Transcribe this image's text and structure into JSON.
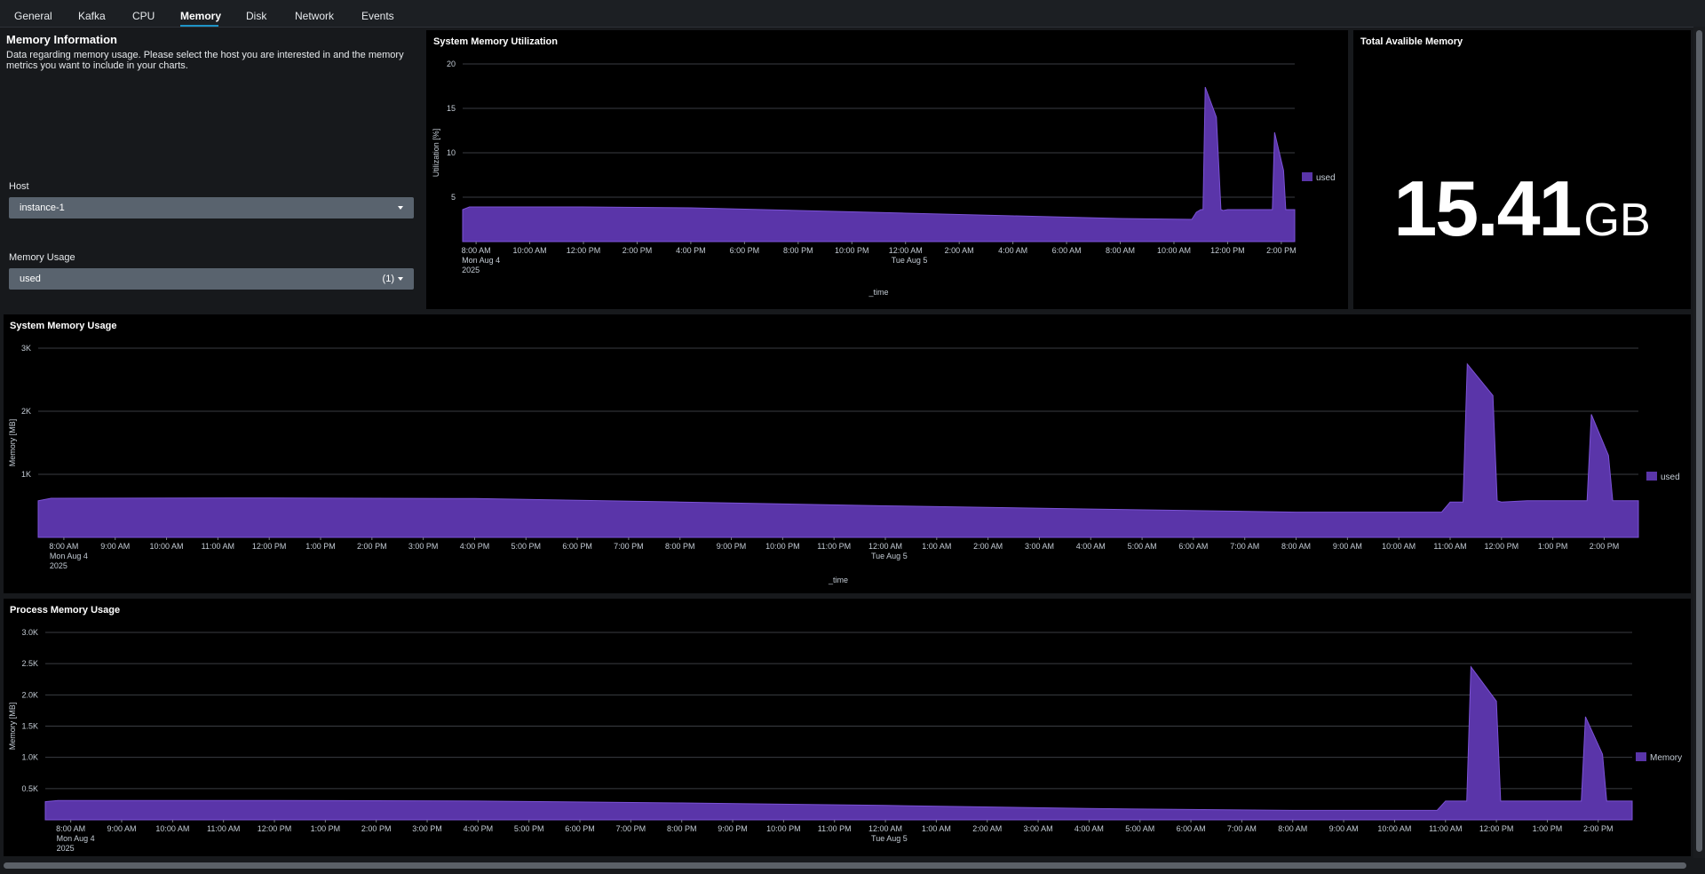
{
  "tabs": [
    {
      "label": "General"
    },
    {
      "label": "Kafka"
    },
    {
      "label": "CPU"
    },
    {
      "label": "Memory",
      "active": true
    },
    {
      "label": "Disk"
    },
    {
      "label": "Network"
    },
    {
      "label": "Events"
    }
  ],
  "info": {
    "title": "Memory Information",
    "description": "Data regarding memory usage. Please select the host you are interested in and the memory metrics you want to include in your charts."
  },
  "host_filter": {
    "label": "Host",
    "value": "instance-1"
  },
  "memory_filter": {
    "label": "Memory Usage",
    "value": "used",
    "count": "(1)"
  },
  "total_memory": {
    "title": "Total Avalible Memory",
    "value": "15.41",
    "unit": "GB"
  },
  "colors": {
    "series": "#5a35a9",
    "series_edge": "#7b52d6",
    "panel_bg": "#000000",
    "page_bg": "#17191c",
    "accent": "#1e93c6"
  },
  "icons": {
    "dropdown": "caret-down-icon"
  },
  "chart_data": [
    {
      "type": "area",
      "title": "System Memory Utilization",
      "xlabel": "_time",
      "ylabel": "Utilization [%]",
      "ylim": [
        0,
        20
      ],
      "yticks": [
        5,
        10,
        15,
        20
      ],
      "yticklabels": [
        "5",
        "10",
        "15",
        "20"
      ],
      "xlim": [
        "2025-08-04 07:30",
        "2025-08-05 14:30"
      ],
      "xticks": [
        "2025-08-04 08:00",
        "2025-08-04 10:00",
        "2025-08-04 12:00",
        "2025-08-04 14:00",
        "2025-08-04 16:00",
        "2025-08-04 18:00",
        "2025-08-04 20:00",
        "2025-08-04 22:00",
        "2025-08-05 00:00",
        "2025-08-05 02:00",
        "2025-08-05 04:00",
        "2025-08-05 06:00",
        "2025-08-05 08:00",
        "2025-08-05 10:00",
        "2025-08-05 12:00",
        "2025-08-05 14:00"
      ],
      "xticklabels": [
        "8:00 AM",
        "10:00 AM",
        "12:00 PM",
        "2:00 PM",
        "4:00 PM",
        "6:00 PM",
        "8:00 PM",
        "10:00 PM",
        "12:00 AM",
        "2:00 AM",
        "4:00 AM",
        "6:00 AM",
        "8:00 AM",
        "10:00 AM",
        "12:00 PM",
        "2:00 PM"
      ],
      "xsublabels": [
        [
          "Mon Aug 4",
          "2025"
        ],
        [],
        [],
        [],
        [],
        [],
        [],
        [],
        [
          "Tue Aug 5"
        ],
        [],
        [],
        [],
        [],
        [],
        [],
        []
      ],
      "legend": "right",
      "grid": true,
      "series": [
        {
          "name": "used",
          "x": [
            "2025-08-04 07:30",
            "2025-08-04 07:45",
            "2025-08-04 12:00",
            "2025-08-04 16:00",
            "2025-08-04 20:00",
            "2025-08-05 00:00",
            "2025-08-05 04:00",
            "2025-08-05 08:00",
            "2025-08-05 10:40",
            "2025-08-05 10:50",
            "2025-08-05 11:00",
            "2025-08-05 11:05",
            "2025-08-05 11:10",
            "2025-08-05 11:35",
            "2025-08-05 11:45",
            "2025-08-05 11:50",
            "2025-08-05 12:00",
            "2025-08-05 12:30",
            "2025-08-05 13:40",
            "2025-08-05 13:45",
            "2025-08-05 14:05",
            "2025-08-05 14:10",
            "2025-08-05 14:20",
            "2025-08-05 14:30"
          ],
          "values": [
            3.6,
            3.9,
            3.9,
            3.8,
            3.5,
            3.2,
            2.9,
            2.6,
            2.5,
            3.3,
            3.6,
            3.6,
            17.4,
            14.0,
            3.6,
            3.5,
            3.6,
            3.6,
            3.6,
            12.3,
            8.0,
            3.6,
            3.6,
            3.6
          ]
        }
      ]
    },
    {
      "type": "area",
      "title": "System Memory Usage",
      "xlabel": "_time",
      "ylabel": "Memory [MB]",
      "ylim": [
        0,
        3000
      ],
      "yticks": [
        1000,
        2000,
        3000
      ],
      "yticklabels": [
        "1K",
        "2K",
        "3K"
      ],
      "xlim": [
        "2025-08-04 07:30",
        "2025-08-05 14:40"
      ],
      "xticks": [
        "2025-08-04 08:00",
        "2025-08-04 09:00",
        "2025-08-04 10:00",
        "2025-08-04 11:00",
        "2025-08-04 12:00",
        "2025-08-04 13:00",
        "2025-08-04 14:00",
        "2025-08-04 15:00",
        "2025-08-04 16:00",
        "2025-08-04 17:00",
        "2025-08-04 18:00",
        "2025-08-04 19:00",
        "2025-08-04 20:00",
        "2025-08-04 21:00",
        "2025-08-04 22:00",
        "2025-08-04 23:00",
        "2025-08-05 00:00",
        "2025-08-05 01:00",
        "2025-08-05 02:00",
        "2025-08-05 03:00",
        "2025-08-05 04:00",
        "2025-08-05 05:00",
        "2025-08-05 06:00",
        "2025-08-05 07:00",
        "2025-08-05 08:00",
        "2025-08-05 09:00",
        "2025-08-05 10:00",
        "2025-08-05 11:00",
        "2025-08-05 12:00",
        "2025-08-05 13:00",
        "2025-08-05 14:00"
      ],
      "xticklabels": [
        "8:00 AM",
        "9:00 AM",
        "10:00 AM",
        "11:00 AM",
        "12:00 PM",
        "1:00 PM",
        "2:00 PM",
        "3:00 PM",
        "4:00 PM",
        "5:00 PM",
        "6:00 PM",
        "7:00 PM",
        "8:00 PM",
        "9:00 PM",
        "10:00 PM",
        "11:00 PM",
        "12:00 AM",
        "1:00 AM",
        "2:00 AM",
        "3:00 AM",
        "4:00 AM",
        "5:00 AM",
        "6:00 AM",
        "7:00 AM",
        "8:00 AM",
        "9:00 AM",
        "10:00 AM",
        "11:00 AM",
        "12:00 PM",
        "1:00 PM",
        "2:00 PM"
      ],
      "xsublabels": [
        [
          "Mon Aug 4",
          "2025"
        ],
        [],
        [],
        [],
        [],
        [],
        [],
        [],
        [],
        [],
        [],
        [],
        [],
        [],
        [],
        [],
        [
          "Tue Aug 5"
        ],
        [],
        [],
        [],
        [],
        [],
        [],
        [],
        [],
        [],
        [],
        [],
        [],
        [],
        []
      ],
      "legend": "right",
      "grid": true,
      "series": [
        {
          "name": "used",
          "x": [
            "2025-08-04 07:30",
            "2025-08-04 07:45",
            "2025-08-04 12:00",
            "2025-08-04 16:00",
            "2025-08-04 20:00",
            "2025-08-05 00:00",
            "2025-08-05 04:00",
            "2025-08-05 08:00",
            "2025-08-05 10:50",
            "2025-08-05 11:00",
            "2025-08-05 11:10",
            "2025-08-05 11:15",
            "2025-08-05 11:20",
            "2025-08-05 11:50",
            "2025-08-05 11:55",
            "2025-08-05 12:00",
            "2025-08-05 12:30",
            "2025-08-05 13:40",
            "2025-08-05 13:45",
            "2025-08-05 14:05",
            "2025-08-05 14:10",
            "2025-08-05 14:20",
            "2025-08-05 14:40"
          ],
          "values": [
            580,
            620,
            625,
            615,
            560,
            500,
            450,
            400,
            400,
            560,
            560,
            560,
            2750,
            2250,
            580,
            560,
            580,
            580,
            1950,
            1300,
            580,
            580,
            580
          ]
        }
      ]
    },
    {
      "type": "area",
      "title": "Process Memory Usage",
      "xlabel": "",
      "ylabel": "Memory [MB]",
      "ylim": [
        0,
        3000
      ],
      "yticks": [
        500,
        1000,
        1500,
        2000,
        2500,
        3000
      ],
      "yticklabels": [
        "0.5K",
        "1.0K",
        "1.5K",
        "2.0K",
        "2.5K",
        "3.0K"
      ],
      "xlim": [
        "2025-08-04 07:30",
        "2025-08-05 14:40"
      ],
      "xticks": [
        "2025-08-04 08:00",
        "2025-08-04 09:00",
        "2025-08-04 10:00",
        "2025-08-04 11:00",
        "2025-08-04 12:00",
        "2025-08-04 13:00",
        "2025-08-04 14:00",
        "2025-08-04 15:00",
        "2025-08-04 16:00",
        "2025-08-04 17:00",
        "2025-08-04 18:00",
        "2025-08-04 19:00",
        "2025-08-04 20:00",
        "2025-08-04 21:00",
        "2025-08-04 22:00",
        "2025-08-04 23:00",
        "2025-08-05 00:00",
        "2025-08-05 01:00",
        "2025-08-05 02:00",
        "2025-08-05 03:00",
        "2025-08-05 04:00",
        "2025-08-05 05:00",
        "2025-08-05 06:00",
        "2025-08-05 07:00",
        "2025-08-05 08:00",
        "2025-08-05 09:00",
        "2025-08-05 10:00",
        "2025-08-05 11:00",
        "2025-08-05 12:00",
        "2025-08-05 13:00",
        "2025-08-05 14:00"
      ],
      "xticklabels": [
        "8:00 AM",
        "9:00 AM",
        "10:00 AM",
        "11:00 AM",
        "12:00 PM",
        "1:00 PM",
        "2:00 PM",
        "3:00 PM",
        "4:00 PM",
        "5:00 PM",
        "6:00 PM",
        "7:00 PM",
        "8:00 PM",
        "9:00 PM",
        "10:00 PM",
        "11:00 PM",
        "12:00 AM",
        "1:00 AM",
        "2:00 AM",
        "3:00 AM",
        "4:00 AM",
        "5:00 AM",
        "6:00 AM",
        "7:00 AM",
        "8:00 AM",
        "9:00 AM",
        "10:00 AM",
        "11:00 AM",
        "12:00 PM",
        "1:00 PM",
        "2:00 PM"
      ],
      "xsublabels": [
        [
          "Mon Aug 4",
          "2025"
        ],
        [],
        [],
        [],
        [],
        [],
        [],
        [],
        [],
        [],
        [],
        [],
        [],
        [],
        [],
        [],
        [
          "Tue Aug 5"
        ],
        [],
        [],
        [],
        [],
        [],
        [],
        [],
        [],
        [],
        [],
        [],
        [],
        [],
        []
      ],
      "legend": "right",
      "grid": true,
      "series": [
        {
          "name": "Memory",
          "x": [
            "2025-08-04 07:30",
            "2025-08-04 07:45",
            "2025-08-04 12:00",
            "2025-08-04 16:00",
            "2025-08-04 20:00",
            "2025-08-05 00:00",
            "2025-08-05 04:00",
            "2025-08-05 08:00",
            "2025-08-05 10:50",
            "2025-08-05 11:00",
            "2025-08-05 11:20",
            "2025-08-05 11:25",
            "2025-08-05 11:30",
            "2025-08-05 12:00",
            "2025-08-05 12:05",
            "2025-08-05 12:10",
            "2025-08-05 12:30",
            "2025-08-05 13:40",
            "2025-08-05 13:45",
            "2025-08-05 14:05",
            "2025-08-05 14:10",
            "2025-08-05 14:20",
            "2025-08-05 14:40"
          ],
          "values": [
            290,
            310,
            310,
            300,
            270,
            230,
            180,
            150,
            150,
            300,
            300,
            300,
            2450,
            1900,
            300,
            300,
            300,
            300,
            1650,
            1050,
            300,
            300,
            300
          ]
        }
      ]
    }
  ]
}
